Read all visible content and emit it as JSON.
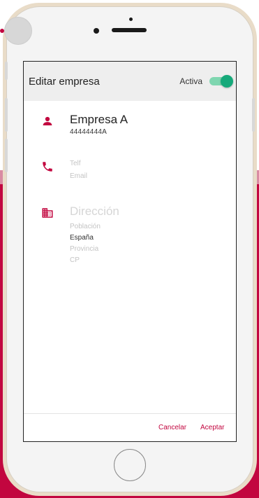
{
  "dialog": {
    "title": "Editar empresa",
    "active_label": "Activa",
    "active_toggle_on": true
  },
  "company": {
    "name": "Empresa A",
    "id": "44444444A"
  },
  "contact": {
    "phone_placeholder": "Telf",
    "email_placeholder": "Email"
  },
  "address": {
    "heading": "Dirección",
    "city_placeholder": "Población",
    "country": "España",
    "province_placeholder": "Provincia",
    "postal_placeholder": "CP"
  },
  "footer": {
    "cancel_label": "Cancelar",
    "accept_label": "Aceptar"
  },
  "colors": {
    "accent": "#c2063f",
    "toggle_on": "#16a97a"
  },
  "icons": [
    "person-icon",
    "phone-icon",
    "building-icon"
  ]
}
